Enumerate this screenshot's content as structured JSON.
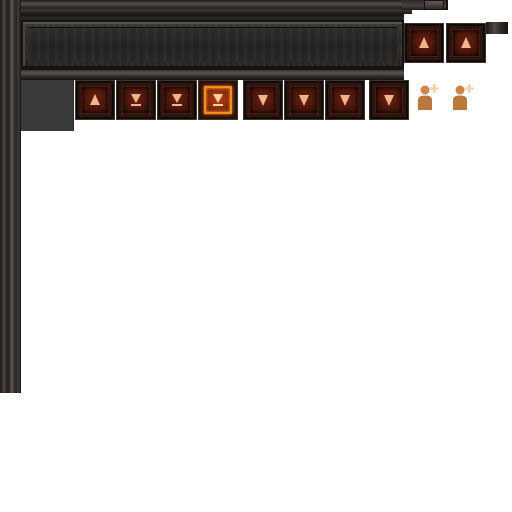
{
  "accent_color": "#ff8a1c",
  "button_color": "#4a160b",
  "top_buttons": [
    {
      "icon": "arrow-up-icon"
    },
    {
      "icon": "arrow-up-icon"
    }
  ],
  "action_buttons": [
    {
      "icon": "arrow-up-icon",
      "active": false
    },
    {
      "icon": "arrow-down-bar-icon",
      "active": false
    },
    {
      "icon": "arrow-down-bar-icon",
      "active": false
    },
    {
      "icon": "arrow-down-bar-icon",
      "active": true
    },
    {
      "icon": "arrow-down-icon",
      "active": false
    },
    {
      "icon": "arrow-down-icon",
      "active": false
    },
    {
      "icon": "arrow-down-icon",
      "active": false
    },
    {
      "icon": "arrow-down-icon",
      "active": false
    }
  ],
  "party_buttons": [
    {
      "icon": "add-player-icon"
    },
    {
      "icon": "add-player-icon"
    }
  ]
}
